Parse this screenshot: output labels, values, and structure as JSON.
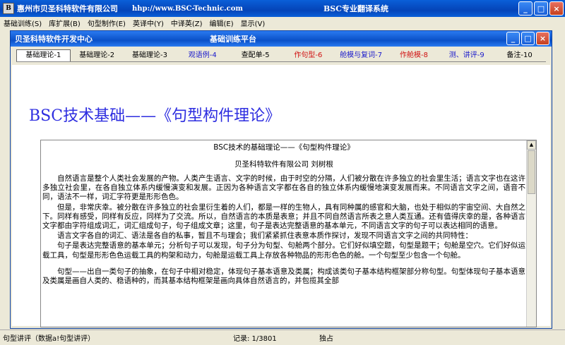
{
  "window": {
    "company": "惠州市贝圣科特软件有限公司",
    "url": "hhp://www.BSC-Technic.com",
    "app_title": "BSC专业翻译系统",
    "icon_glyph": "B"
  },
  "menu": [
    "基础训练(S)",
    "库扩展(B)",
    "句型制作(E)",
    "英译中(Y)",
    "中译英(Z)",
    "编辑(E)",
    "显示(V)"
  ],
  "inner_window": {
    "developer": "贝圣科特软件开发中心",
    "module": "基础训练平台"
  },
  "tabs": [
    {
      "label": "基础理论-1",
      "color": "#000000"
    },
    {
      "label": "基础理论-2",
      "color": "#000000"
    },
    {
      "label": "基础理论-3",
      "color": "#000000"
    },
    {
      "label": "观语例-4",
      "color": "#1a1acc"
    },
    {
      "label": "查配单-5",
      "color": "#000000"
    },
    {
      "label": "作句型-6",
      "color": "#d01010"
    },
    {
      "label": "舱模与复词-7",
      "color": "#1a1acc"
    },
    {
      "label": "作舱模-8",
      "color": "#d01010"
    },
    {
      "label": "测、讲评-9",
      "color": "#1a1acc"
    },
    {
      "label": "备注-10",
      "color": "#000000"
    }
  ],
  "content": {
    "heading": "BSC技术基础——《句型构件理论》",
    "doc_title": "BSC技术的基础理论——《句型构件理论》",
    "doc_author": "贝圣科特软件有限公司 刘树根",
    "paragraphs": [
      "自然语言是整个人类社会发展的产物。人类产生语言、文字的时候，由于时空的分隔，人们被分散在许多独立的社会里生活；语言文字也在这许多独立社会里，在各自独立体系内缓慢演变和发展。正因为各种语言文字都在各自的独立体系内缓慢地演变发展而来。不同语言文字之间，语音不同，语法不一样，词汇字符更是形形色色。",
      "但是，非常庆幸。被分散在许多独立的社会里衍生着的人们，都是一样的生物人，具有同种属的感官和大脑，也处于相似的宇宙空间、大自然之下。同样有感受，同样有反应，同样为了交流。所以，自然语言的本质是表意；并且不同自然语言所表之意人类互通。还有值得庆幸的是，各种语言文字都由字符组成词汇，词汇组成句子，句子组成文章；这里，句子是表达完整语意的基本单元，不同语言文字的句子可以表达相同的语意。",
      "语言文字各自的词汇、语法是各自的私事，暂且不与理会；我们紧紧抓住表意本质作探讨，发现不同语言文字之间的共同特性：",
      "句子是表达完整语意的基本单元；分析句子可以发现，句子分为句型、句舱两个部分。它们好似填空题，句型是题干；句舱是空穴。它们好似运载工具，句型是形形色色运载工具的构架和动力，句舱是运载工具上存放各种物品的形形色色的舱。一个句型至少包含一个句舱。",
      "句型——出自一类句子的抽象，在句子中相对稳定，体现句子基本语意及类属；构成该类句子基本结构框架部分称句型。句型体现句子基本语意及类属是画自人类的、稳语种的，而其基本结构框架是画向具体自然语言的，并包揽其全部"
    ]
  },
  "status": {
    "left": "句型讲评（数据a!句型讲评）",
    "record": "记录: 1/3801",
    "mode": "独占"
  }
}
